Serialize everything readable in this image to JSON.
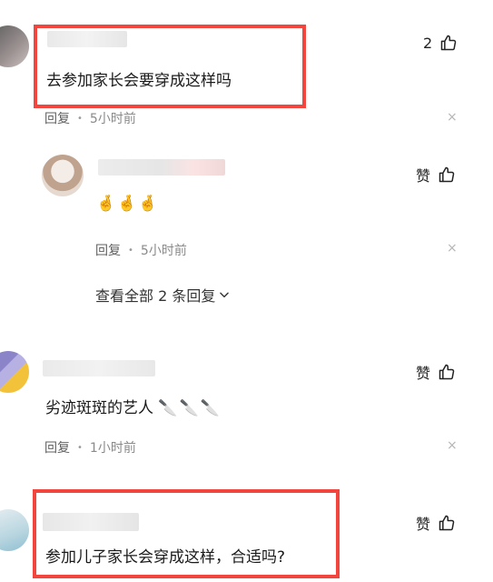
{
  "accent": "#f2453d",
  "comments": [
    {
      "text": "去参加家长会要穿成这样吗",
      "reply_label": "回复",
      "time": "5小时前",
      "likes": "2",
      "close": "×"
    },
    {
      "text": "🤞🤞🤞",
      "reply_label": "回复",
      "time": "5小时前",
      "likes": "赞",
      "close": "×",
      "view_all": "查看全部 2 条回复"
    },
    {
      "text": "劣迹斑斑的艺人",
      "emoji": "🔪🔪🔪",
      "reply_label": "回复",
      "time": "1小时前",
      "likes": "赞",
      "close": "×"
    },
    {
      "text": "参加儿子家长会穿成这样，合适吗?",
      "likes": "赞"
    }
  ],
  "icons": [
    "thumbs-up-icon",
    "close-icon",
    "chevron-down-icon"
  ]
}
